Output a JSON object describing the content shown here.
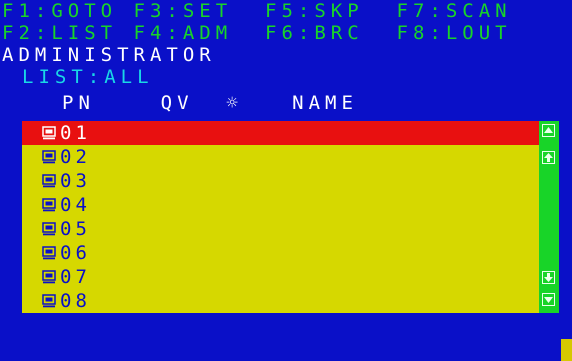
{
  "hotkeys": {
    "row1": [
      {
        "key": "F1",
        "label": "GOTO"
      },
      {
        "key": "F3",
        "label": "SET"
      },
      {
        "key": "F5",
        "label": "SKP"
      },
      {
        "key": "F7",
        "label": "SCAN"
      }
    ],
    "row2": [
      {
        "key": "F2",
        "label": "LIST"
      },
      {
        "key": "F4",
        "label": "ADM"
      },
      {
        "key": "F6",
        "label": "BRC"
      },
      {
        "key": "F8",
        "label": "LOUT"
      }
    ],
    "line1": "F1:GOTO F3:SET  F5:SKP  F7:SCAN",
    "line2": "F2:LIST F4:ADM  F6:BRC  F8:LOUT"
  },
  "user_mode": "ADMINISTRATOR",
  "list_filter": "LIST:ALL",
  "columns": {
    "pn": "PN",
    "qv": "QV",
    "power_icon": "sun-power-icon",
    "name": "NAME",
    "line": "PN    QV  ☼   NAME"
  },
  "ports": [
    {
      "pn": "01",
      "name": "",
      "selected": true
    },
    {
      "pn": "02",
      "name": "",
      "selected": false
    },
    {
      "pn": "03",
      "name": "",
      "selected": false
    },
    {
      "pn": "04",
      "name": "",
      "selected": false
    },
    {
      "pn": "05",
      "name": "",
      "selected": false
    },
    {
      "pn": "06",
      "name": "",
      "selected": false
    },
    {
      "pn": "07",
      "name": "",
      "selected": false
    },
    {
      "pn": "08",
      "name": "",
      "selected": false
    }
  ],
  "port_icon": "computer-icon",
  "scrollbar_icons": [
    "line-up-icon",
    "page-up-icon",
    "page-down-icon",
    "line-down-icon"
  ],
  "colors": {
    "background": "#0a10c8",
    "hotkey_text": "#18d428",
    "list_bg": "#d6d800",
    "selected_row": "#e81010",
    "header_text": "#19d7e6"
  }
}
